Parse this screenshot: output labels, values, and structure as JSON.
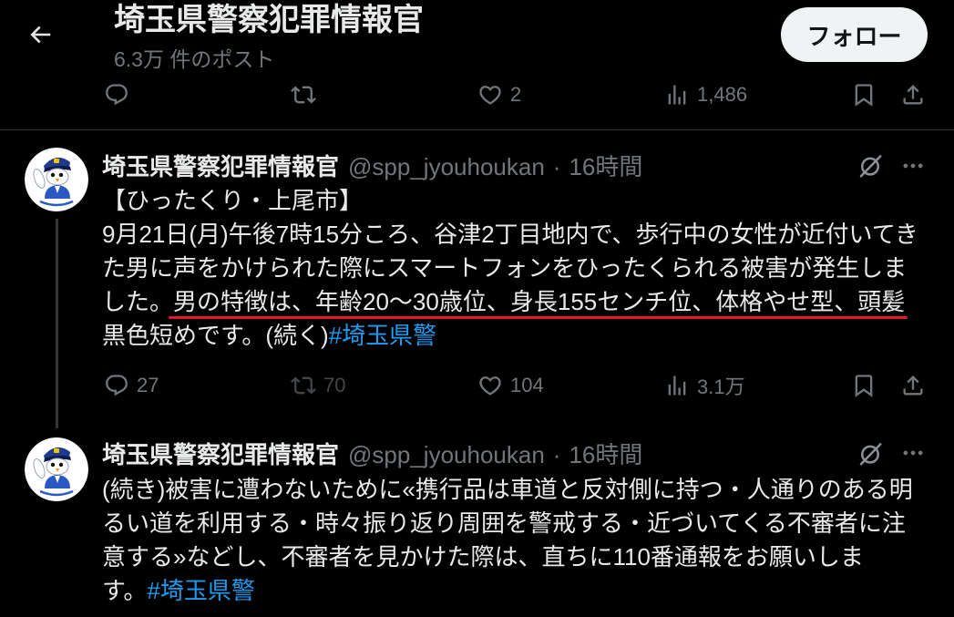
{
  "colors": {
    "background": "#000000",
    "text_primary": "#e7e9ea",
    "text_secondary": "#71767b",
    "divider": "#2f3336",
    "hashtag_link": "#1d9bf0",
    "follow_button_background": "#eff3f4",
    "follow_button_text": "#0f1419",
    "annotation_underline": "#e3172d"
  },
  "icons": {
    "back": "arrow-left-icon",
    "reply": "reply-icon",
    "repost": "repost-icon",
    "like": "heart-icon",
    "views": "views-icon",
    "bookmark": "bookmark-icon",
    "share": "share-icon",
    "grok": "grok-icon",
    "more": "more-icon"
  },
  "header": {
    "title": "埼玉県警察犯罪情報官",
    "post_count": "6.3万 件のポスト",
    "follow_label": "フォロー"
  },
  "previous_post": {
    "actions": {
      "like_count": "2",
      "view_count": "1,486"
    }
  },
  "posts": [
    {
      "author_name": "埼玉県警察犯罪情報官",
      "handle": "@spp_jyouhoukan",
      "separator": "·",
      "time": "16時間",
      "body_lines": [
        [
          "【ひったくり・上尾市】"
        ],
        [
          "9月21日(月)午後7時15分ころ、谷津2丁目地内で、歩行中の女性が近付いてき"
        ],
        [
          "た男に声をかけられた際にスマートフォンをひったくられる被害が発生しま"
        ],
        [
          "した。",
          "男の特徴は、年齢20～30歳位、身長155センチ位、体格やせ型、頭髪"
        ],
        [
          "黒色短めです。(続く)",
          "#埼玉県警"
        ]
      ],
      "actions": {
        "reply_count": "27",
        "repost_count": "70",
        "like_count": "104",
        "view_count": "3.1万"
      }
    },
    {
      "author_name": "埼玉県警察犯罪情報官",
      "handle": "@spp_jyouhoukan",
      "separator": "·",
      "time": "16時間",
      "body_lines": [
        [
          "(続き)被害に遭わないために«携行品は車道と反対側に持つ・人通りのある明"
        ],
        [
          "るい道を利用する・時々振り返り周囲を警戒する・近づいてくる不審者に注"
        ],
        [
          "意する»などし、不審者を見かけた際は、直ちに110番通報をお願いしま"
        ],
        [
          "す。",
          "#埼玉県警"
        ]
      ]
    }
  ]
}
